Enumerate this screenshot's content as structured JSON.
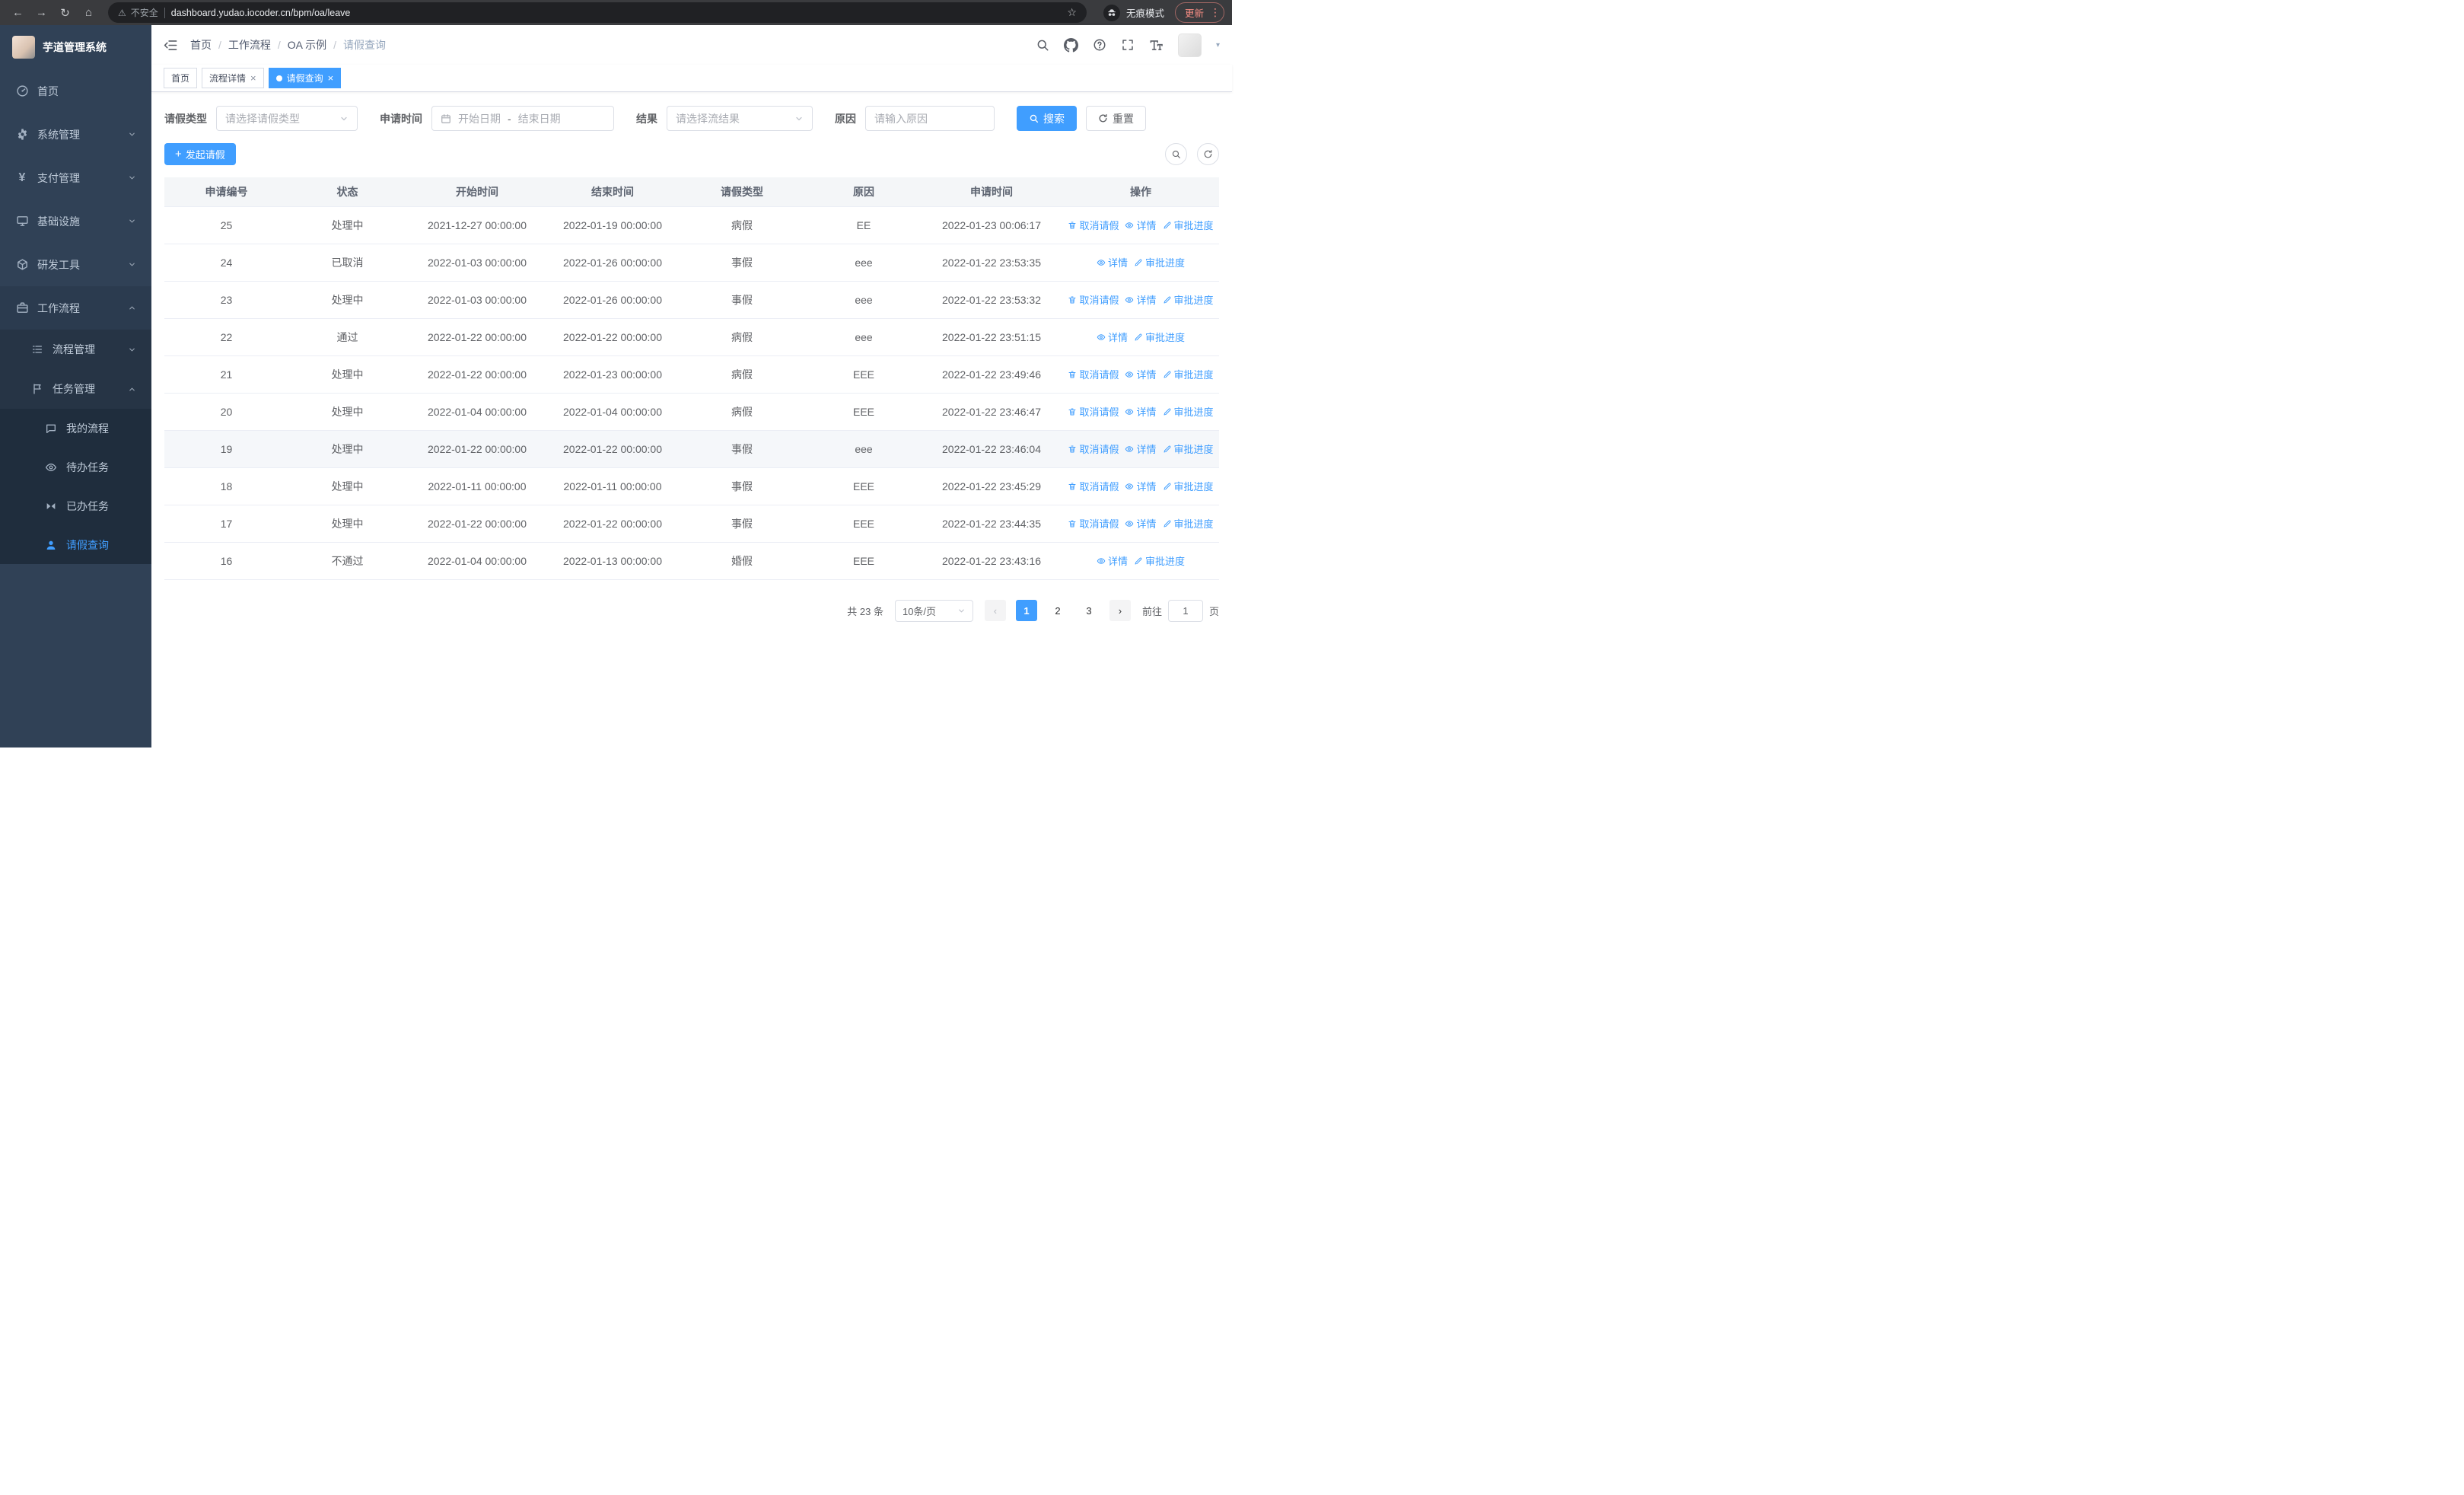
{
  "browser": {
    "security_label": "不安全",
    "url": "dashboard.yudao.iocoder.cn/bpm/oa/leave",
    "incognito_label": "无痕模式",
    "update_label": "更新"
  },
  "sidebar": {
    "app_title": "芋道管理系统",
    "items": [
      {
        "label": "首页"
      },
      {
        "label": "系统管理"
      },
      {
        "label": "支付管理"
      },
      {
        "label": "基础设施"
      },
      {
        "label": "研发工具"
      },
      {
        "label": "工作流程"
      }
    ],
    "workflow_children": [
      {
        "label": "流程管理"
      },
      {
        "label": "任务管理"
      }
    ],
    "task_children": [
      {
        "label": "我的流程"
      },
      {
        "label": "待办任务"
      },
      {
        "label": "已办任务"
      },
      {
        "label": "请假查询"
      }
    ]
  },
  "header": {
    "breadcrumb": [
      "首页",
      "工作流程",
      "OA 示例",
      "请假查询"
    ]
  },
  "tabs": [
    {
      "label": "首页"
    },
    {
      "label": "流程详情"
    },
    {
      "label": "请假查询"
    }
  ],
  "filters": {
    "leave_type": {
      "label": "请假类型",
      "placeholder": "请选择请假类型"
    },
    "apply_time": {
      "label": "申请时间",
      "start_placeholder": "开始日期",
      "separator": "-",
      "end_placeholder": "结束日期"
    },
    "result": {
      "label": "结果",
      "placeholder": "请选择流结果"
    },
    "reason": {
      "label": "原因",
      "placeholder": "请输入原因"
    },
    "search_label": "搜索",
    "reset_label": "重置"
  },
  "toolbar": {
    "create_label": "发起请假"
  },
  "table": {
    "columns": [
      "申请编号",
      "状态",
      "开始时间",
      "结束时间",
      "请假类型",
      "原因",
      "申请时间",
      "操作"
    ],
    "action_labels": {
      "cancel": "取消请假",
      "detail": "详情",
      "progress": "审批进度"
    },
    "rows": [
      {
        "id": "25",
        "status": "处理中",
        "start_time": "2021-12-27 00:00:00",
        "end_time": "2022-01-19 00:00:00",
        "leave_type": "病假",
        "reason": "EE",
        "apply_time": "2022-01-23 00:06:17",
        "can_cancel": true,
        "highlighted": false
      },
      {
        "id": "24",
        "status": "已取消",
        "start_time": "2022-01-03 00:00:00",
        "end_time": "2022-01-26 00:00:00",
        "leave_type": "事假",
        "reason": "eee",
        "apply_time": "2022-01-22 23:53:35",
        "can_cancel": false,
        "highlighted": false
      },
      {
        "id": "23",
        "status": "处理中",
        "start_time": "2022-01-03 00:00:00",
        "end_time": "2022-01-26 00:00:00",
        "leave_type": "事假",
        "reason": "eee",
        "apply_time": "2022-01-22 23:53:32",
        "can_cancel": true,
        "highlighted": false
      },
      {
        "id": "22",
        "status": "通过",
        "start_time": "2022-01-22 00:00:00",
        "end_time": "2022-01-22 00:00:00",
        "leave_type": "病假",
        "reason": "eee",
        "apply_time": "2022-01-22 23:51:15",
        "can_cancel": false,
        "highlighted": false
      },
      {
        "id": "21",
        "status": "处理中",
        "start_time": "2022-01-22 00:00:00",
        "end_time": "2022-01-23 00:00:00",
        "leave_type": "病假",
        "reason": "EEE",
        "apply_time": "2022-01-22 23:49:46",
        "can_cancel": true,
        "highlighted": false
      },
      {
        "id": "20",
        "status": "处理中",
        "start_time": "2022-01-04 00:00:00",
        "end_time": "2022-01-04 00:00:00",
        "leave_type": "病假",
        "reason": "EEE",
        "apply_time": "2022-01-22 23:46:47",
        "can_cancel": true,
        "highlighted": false
      },
      {
        "id": "19",
        "status": "处理中",
        "start_time": "2022-01-22 00:00:00",
        "end_time": "2022-01-22 00:00:00",
        "leave_type": "事假",
        "reason": "eee",
        "apply_time": "2022-01-22 23:46:04",
        "can_cancel": true,
        "highlighted": true
      },
      {
        "id": "18",
        "status": "处理中",
        "start_time": "2022-01-11 00:00:00",
        "end_time": "2022-01-11 00:00:00",
        "leave_type": "事假",
        "reason": "EEE",
        "apply_time": "2022-01-22 23:45:29",
        "can_cancel": true,
        "highlighted": false
      },
      {
        "id": "17",
        "status": "处理中",
        "start_time": "2022-01-22 00:00:00",
        "end_time": "2022-01-22 00:00:00",
        "leave_type": "事假",
        "reason": "EEE",
        "apply_time": "2022-01-22 23:44:35",
        "can_cancel": true,
        "highlighted": false
      },
      {
        "id": "16",
        "status": "不通过",
        "start_time": "2022-01-04 00:00:00",
        "end_time": "2022-01-13 00:00:00",
        "leave_type": "婚假",
        "reason": "EEE",
        "apply_time": "2022-01-22 23:43:16",
        "can_cancel": false,
        "highlighted": false
      }
    ]
  },
  "pagination": {
    "total_label": "共 23 条",
    "page_size_label": "10条/页",
    "pages": [
      "1",
      "2",
      "3"
    ],
    "active_page": "1",
    "goto_label": "前往",
    "goto_value": "1",
    "goto_suffix": "页"
  },
  "colors": {
    "primary": "#409eff",
    "sidebar_bg": "#304156",
    "sidebar_sub_bg": "#1f2d3d",
    "update_chip_text": "#f28b82"
  }
}
